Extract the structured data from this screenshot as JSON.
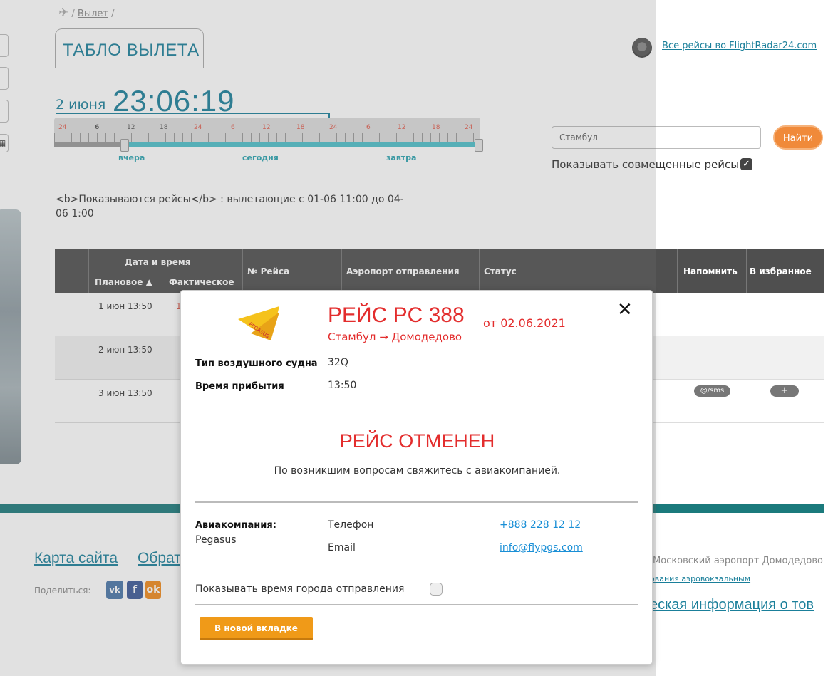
{
  "breadcrumb": {
    "separator": "/",
    "current": "Вылет"
  },
  "tabs": {
    "departures": "ТАБЛО ВЫЛЕТА"
  },
  "flightradar": {
    "link": "Все рейсы во FlightRadar24.com"
  },
  "clock": {
    "date": "2 июня",
    "time": "23:06:19"
  },
  "timeline": {
    "ticks": [
      "24",
      "6",
      "12",
      "18",
      "24",
      "6",
      "12",
      "18",
      "24",
      "6",
      "12",
      "18",
      "24"
    ],
    "days": [
      "вчера",
      "сегодня",
      "завтра"
    ]
  },
  "search": {
    "value": "Стамбул",
    "button": "Найти",
    "combined_label": "Показывать совмещенные рейсы",
    "combined_checked": true
  },
  "showing_text": "<b>Показываются рейсы</b> : вылетающие с 01-06 11:00 до 04-06 1:00",
  "table": {
    "group_header": "Дата и время",
    "headers": {
      "planned": "Плановое ▲",
      "actual": "Фактическое",
      "flight": "№ Рейса",
      "airport": "Аэропорт отправления",
      "status": "Статус",
      "remind": "Напомнить",
      "favorite": "В избранное"
    },
    "rows": [
      {
        "planned": "1 июн  13:50",
        "actual": "1"
      },
      {
        "planned": "2 июн  13:50",
        "actual": ""
      },
      {
        "planned": "3 июн  13:50",
        "actual": "",
        "remind": "@/sms",
        "favorite": "+"
      }
    ]
  },
  "footer": {
    "sitemap": "Карта сайта",
    "feedback": "Обрат",
    "share": "Поделиться:",
    "social": [
      "vk",
      "f",
      "ok"
    ],
    "right1": "Московский аэропорт Домодедово",
    "right2": "ования аэровокзальным",
    "right3": "еская информация о тов"
  },
  "modal": {
    "airline_logo": "pegasus-logo",
    "flight": "РЕЙС PC 388",
    "from_date": "от 02.06.2021",
    "route": "Стамбул → Домодедово",
    "aircraft_label": "Тип воздушного судна",
    "aircraft_value": "32Q",
    "arrival_label": "Время прибытия",
    "arrival_value": "13:50",
    "cancelled": "РЕЙС ОТМЕНЕН",
    "question": "По возникшим вопросам свяжитесь с авиакомпанией.",
    "airline_label": "Авиакомпания:",
    "airline_name": "Pegasus",
    "phone_label": "Телефон",
    "phone_value": "+888 228 12 12",
    "email_label": "Email",
    "email_value": "info@flypgs.com",
    "show_time_label": "Показывать время города отправления",
    "new_tab": "В новой вкладке",
    "colors": {
      "accent": "#e32d2d",
      "button": "#f09a18",
      "link": "#1a8fd6"
    }
  }
}
